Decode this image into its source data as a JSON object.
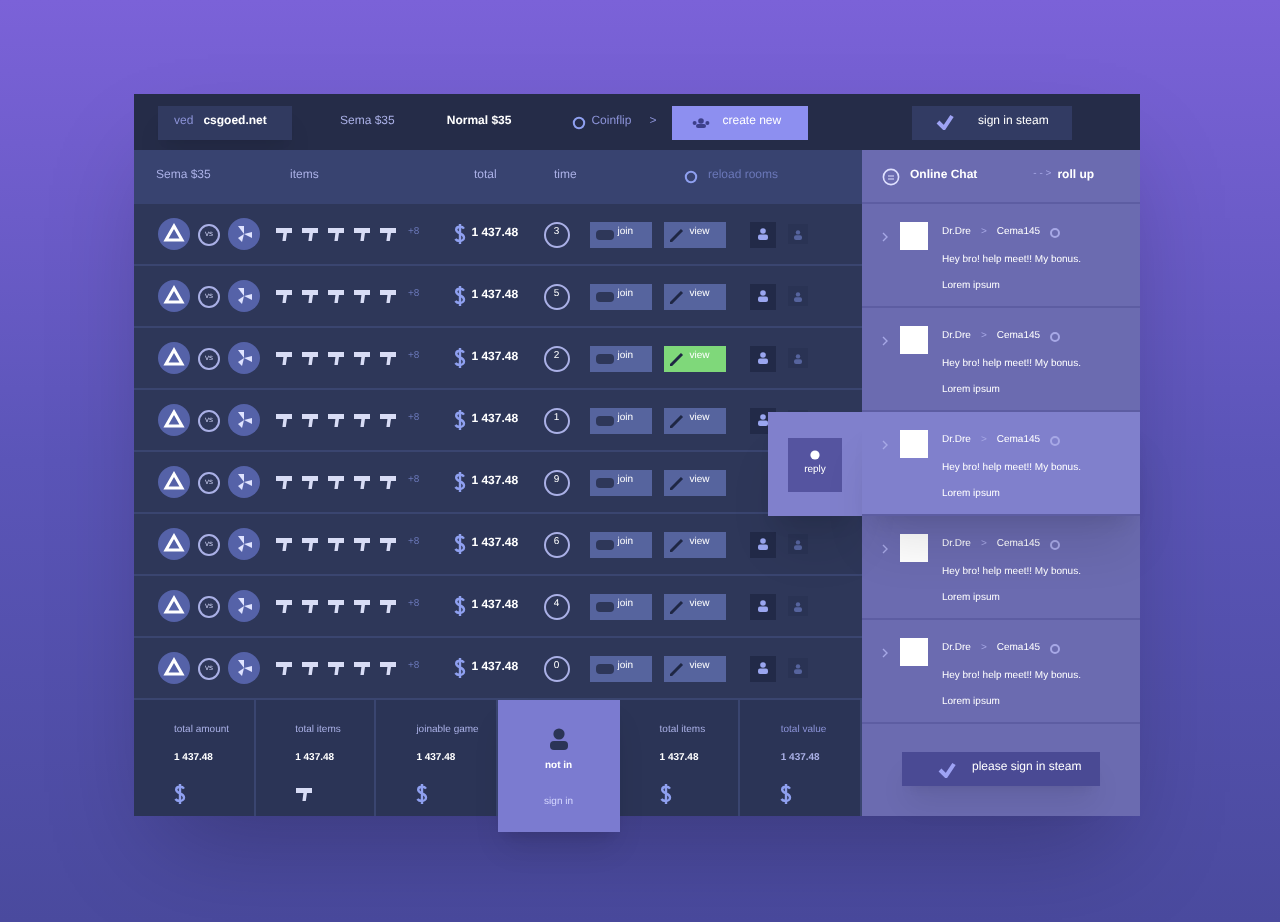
{
  "top_bar": {
    "site": {
      "prefix": "ved",
      "name": "csgoed.net"
    },
    "tabs": [
      {
        "label": "Sema $35",
        "selected": false
      },
      {
        "label": "Normal $35",
        "selected": true
      }
    ],
    "coinflip": "Coinflip",
    "chevron": ">",
    "create_button": "create new",
    "steam_button": "sign in steam"
  },
  "table": {
    "columns": [
      "Sema $35",
      "items",
      "total",
      "time"
    ],
    "reload": "reload rooms",
    "rows": [
      {
        "vs": "vs",
        "extra": "+8",
        "total": "1 437.48",
        "time": "3",
        "join": "join",
        "view": "view",
        "view_active": false,
        "covered": false
      },
      {
        "vs": "vs",
        "extra": "+8",
        "total": "1 437.48",
        "time": "5",
        "join": "join",
        "view": "view",
        "view_active": false,
        "covered": false
      },
      {
        "vs": "vs",
        "extra": "+8",
        "total": "1 437.48",
        "time": "2",
        "join": "join",
        "view": "view",
        "view_active": true,
        "covered": false
      },
      {
        "vs": "vs",
        "extra": "+8",
        "total": "1 437.48",
        "time": "1",
        "join": "join",
        "view": "view",
        "view_active": false,
        "covered": false
      },
      {
        "vs": "vs",
        "extra": "+8",
        "total": "1 437.48",
        "time": "9",
        "join": "join",
        "view": "view",
        "view_active": false,
        "covered": true
      },
      {
        "vs": "vs",
        "extra": "+8",
        "total": "1 437.48",
        "time": "6",
        "join": "join",
        "view": "view",
        "view_active": false,
        "covered": false
      },
      {
        "vs": "vs",
        "extra": "+8",
        "total": "1 437.48",
        "time": "4",
        "join": "join",
        "view": "view",
        "view_active": false,
        "covered": false
      },
      {
        "vs": "vs",
        "extra": "+8",
        "total": "1 437.48",
        "time": "0",
        "join": "join",
        "view": "view",
        "view_active": false,
        "covered": false
      }
    ]
  },
  "footer": {
    "stats": [
      {
        "label": "total amount",
        "value": "1 437.48",
        "kind": "dollar"
      },
      {
        "label": "total items",
        "value": "1 437.48",
        "kind": "gun"
      },
      {
        "label": "joinable game",
        "value": "1 437.48",
        "kind": "dollar"
      },
      {
        "label": "total items",
        "value": "1 437.48",
        "kind": "dollar"
      },
      {
        "label": "total value",
        "value": "1 437.48",
        "kind": "dollar"
      }
    ],
    "status": {
      "title": "not in",
      "link": "sign in"
    }
  },
  "chat": {
    "title": "Online Chat",
    "arrows": "- - >",
    "roll_up": "roll up",
    "messages": [
      {
        "from": "Dr.Dre",
        "sep": ">",
        "to": "Cema145",
        "text": "Hey bro! help meet!! My bonus.",
        "sub": "Lorem ipsum",
        "highlighted": false
      },
      {
        "from": "Dr.Dre",
        "sep": ">",
        "to": "Cema145",
        "text": "Hey bro! help meet!! My bonus.",
        "sub": "Lorem ipsum",
        "highlighted": false
      },
      {
        "from": "Dr.Dre",
        "sep": ">",
        "to": "Cema145",
        "text": "Hey bro! help meet!! My bonus.",
        "sub": "Lorem ipsum",
        "highlighted": true,
        "reply": "reply"
      },
      {
        "from": "Dr.Dre",
        "sep": ">",
        "to": "Cema145",
        "text": "Hey bro! help meet!! My bonus.",
        "sub": "Lorem ipsum",
        "highlighted": false
      },
      {
        "from": "Dr.Dre",
        "sep": ">",
        "to": "Cema145",
        "text": "Hey bro! help meet!! My bonus.",
        "sub": "Lorem ipsum",
        "highlighted": false
      }
    ],
    "sign_in": "please sign in steam"
  }
}
